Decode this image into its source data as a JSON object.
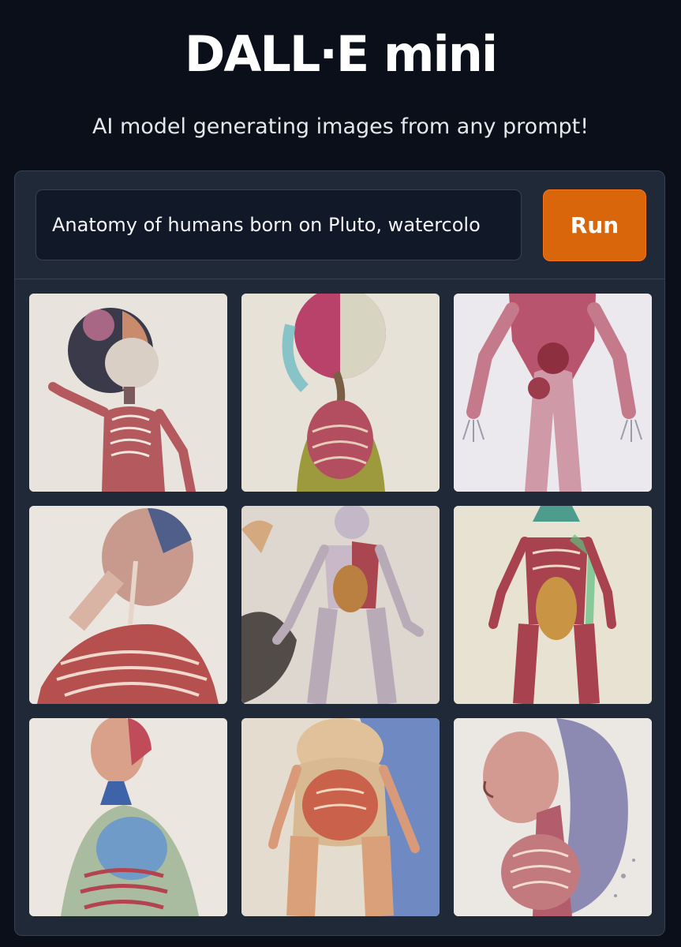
{
  "header": {
    "title": "DALL·E mini",
    "subtitle": "AI model generating images from any prompt!"
  },
  "prompt": {
    "value": "Anatomy of humans born on Pluto, watercolo",
    "run_label": "Run"
  },
  "colors": {
    "background": "#0b0f19",
    "panel": "#1f2937",
    "input": "#111827",
    "accent": "#d9660a"
  },
  "gallery": {
    "images": [
      {
        "name": "generated-image-1"
      },
      {
        "name": "generated-image-2"
      },
      {
        "name": "generated-image-3"
      },
      {
        "name": "generated-image-4"
      },
      {
        "name": "generated-image-5"
      },
      {
        "name": "generated-image-6"
      },
      {
        "name": "generated-image-7"
      },
      {
        "name": "generated-image-8"
      },
      {
        "name": "generated-image-9"
      }
    ]
  }
}
